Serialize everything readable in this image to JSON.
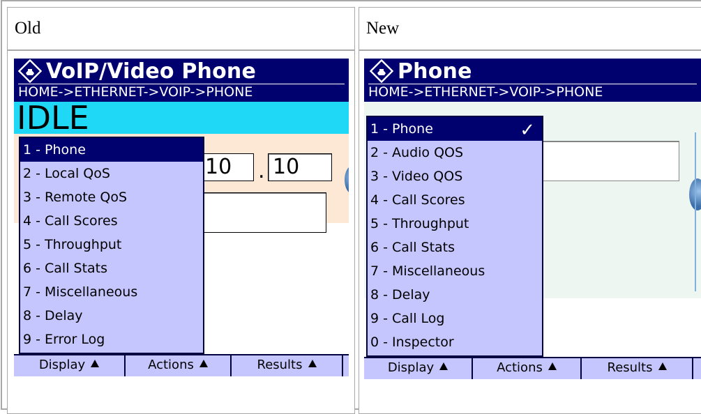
{
  "columns": {
    "old_label": "Old",
    "new_label": "New"
  },
  "old": {
    "title": "VoIP/Video Phone",
    "breadcrumb": "HOME->ETHERNET->VOIP->PHONE",
    "status": "IDLE",
    "ip_fields": [
      "10",
      "10"
    ],
    "ip_separator": ".",
    "menu_items": [
      "1 - Phone",
      "2 - Local QoS",
      "3 - Remote QoS",
      "4 - Call Scores",
      "5 - Throughput",
      "6 - Call Stats",
      "7 - Miscellaneous",
      "8 - Delay",
      "9 - Error Log"
    ],
    "selected_index": 0,
    "softkeys": [
      "Display",
      "Actions",
      "Results"
    ],
    "colors": {
      "status_bar": "#1ed8f5",
      "content_bg": "#fde8d6"
    }
  },
  "new": {
    "title": "Phone",
    "breadcrumb": "HOME->ETHERNET->VOIP->PHONE",
    "menu_items": [
      "1 - Phone",
      "2 - Audio QOS",
      "3 - Video QOS",
      "4 - Call Scores",
      "5 - Throughput",
      "6 - Call Stats",
      "7 - Miscellaneous",
      "8 - Delay",
      "9 - Call Log",
      "0 - Inspector"
    ],
    "selected_index": 0,
    "selected_mark": "✓",
    "softkeys": [
      "Display",
      "Actions",
      "Results"
    ],
    "colors": {
      "status_bar": "#eef6f2",
      "content_bg": "#eef6f2"
    }
  },
  "theme": {
    "title_bar": "#00006e",
    "menu_bg": "#c6c6ff",
    "menu_selected": "#00006e",
    "orb": "#4a7fb8"
  },
  "icons": {
    "app": "phone-ring-icon",
    "softkey_arrow": "triangle-up-icon",
    "orb": "blue-orb-icon"
  }
}
